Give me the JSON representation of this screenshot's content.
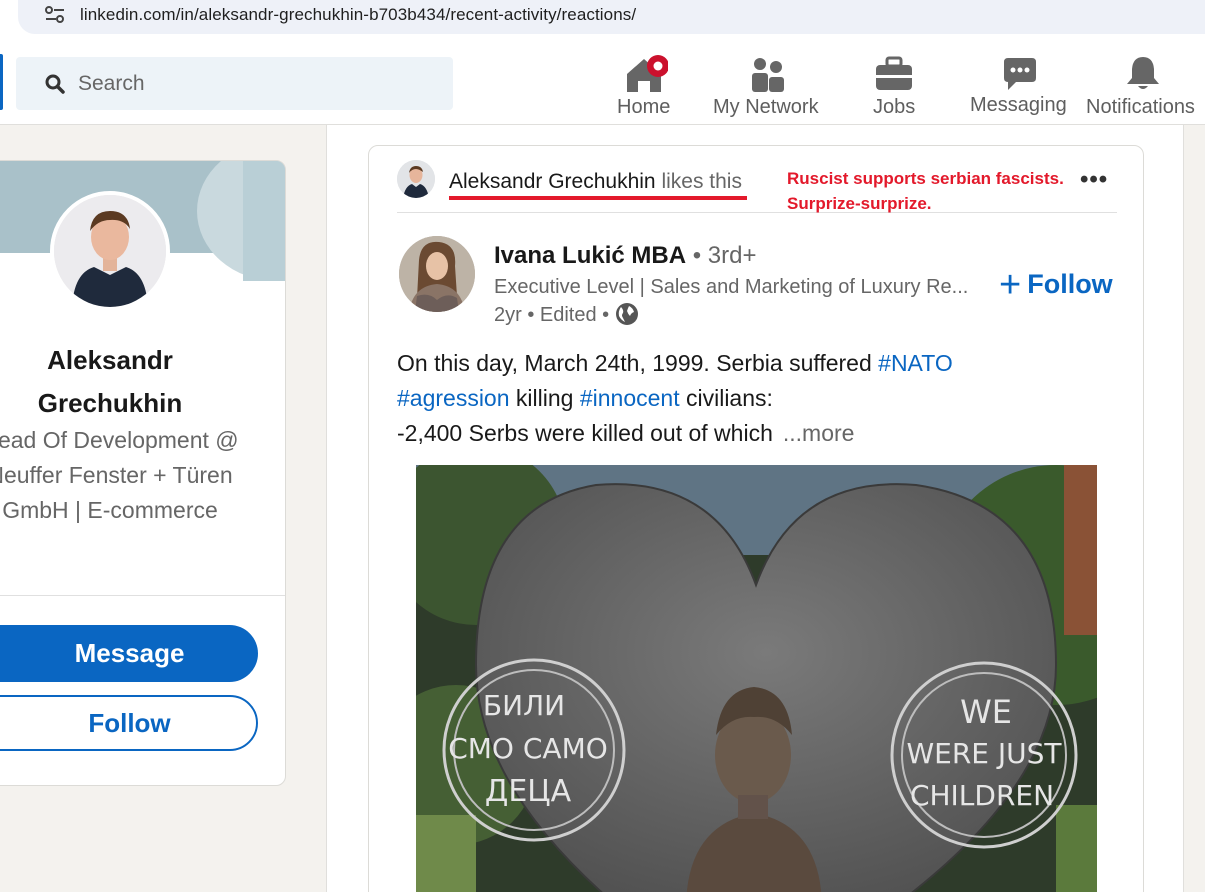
{
  "browser": {
    "url": "linkedin.com/in/aleksandr-grechukhin-b703b434/recent-activity/reactions/",
    "site_settings_icon": "tune-icon"
  },
  "header": {
    "search_placeholder": "Search",
    "nav": [
      {
        "label": "Home",
        "icon": "home-icon",
        "badge_color": "#cb112d"
      },
      {
        "label": "My Network",
        "icon": "network-icon"
      },
      {
        "label": "Jobs",
        "icon": "briefcase-icon"
      },
      {
        "label": "Messaging",
        "icon": "chat-icon"
      },
      {
        "label": "Notifications",
        "icon": "bell-icon"
      }
    ]
  },
  "profile": {
    "name": "Aleksandr Grechukhin",
    "headline": "Head Of Development @ Neuffer Fenster + Türen GmbH | E-commerce",
    "message_label": "Message",
    "follow_label": "Follow"
  },
  "activity": {
    "actor": "Aleksandr Grechukhin",
    "action": " likes this",
    "annotation_line1": "Ruscist supports serbian fascists.",
    "annotation_line2": "Surprize-surprize.",
    "menu": "•••"
  },
  "post": {
    "author": "Ivana Lukić MBA",
    "degree": " • 3rd+",
    "headline": "Executive Level | Sales and Marketing of Luxury Re...",
    "meta": "2yr • Edited • ",
    "follow_label": "Follow",
    "text": {
      "part1": "On this day, March 24th, 1999. Serbia suffered ",
      "tag1": "#NATO",
      "tag2": "#agression",
      "part2": " killing ",
      "tag3": "#innocent",
      "part3": " civilians:",
      "line3": "-2,400 Serbs were killed out of which",
      "more": "...more"
    },
    "image": {
      "left_inscription": [
        "БИЛИ",
        "СМО САМО",
        "ДЕЦА"
      ],
      "right_inscription": [
        "WE",
        "WERE JUST",
        "CHILDREN"
      ]
    }
  },
  "colors": {
    "linkedin_blue": "#0a66c2",
    "annotation_red": "#e3192b"
  }
}
